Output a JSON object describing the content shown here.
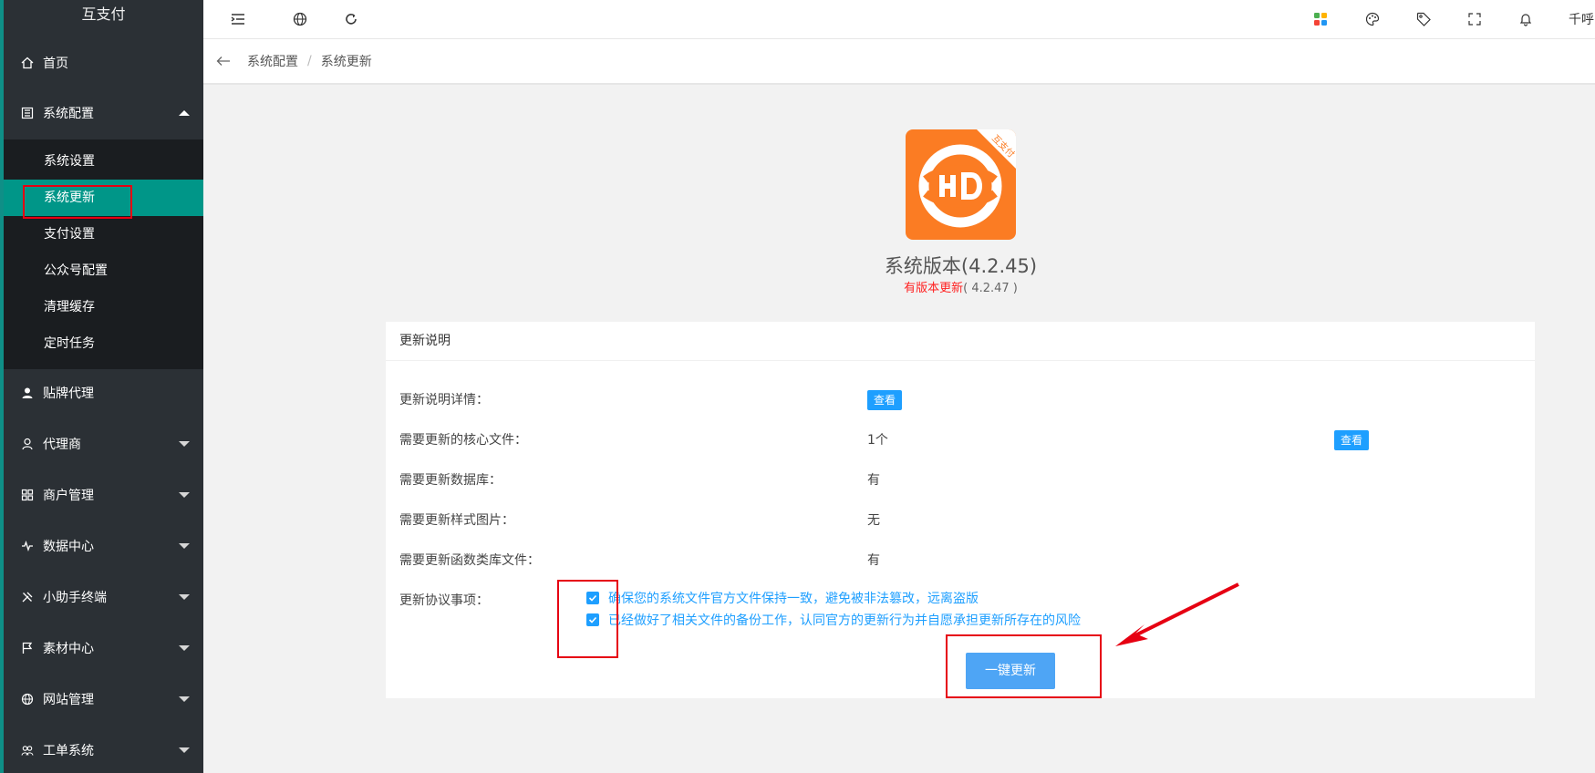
{
  "sidebar": {
    "logo": "互支付",
    "home": "首页",
    "system_config": "系统配置",
    "submenu": [
      "系统设置",
      "系统更新",
      "支付设置",
      "公众号配置",
      "清理缓存",
      "定时任务"
    ],
    "items": [
      "贴牌代理",
      "代理商",
      "商户管理",
      "数据中心",
      "小助手终端",
      "素材中心",
      "网站管理",
      "工单系统"
    ]
  },
  "topbar": {
    "user": "千呼"
  },
  "breadcrumb": {
    "parent": "系统配置",
    "current": "系统更新",
    "separator": "/"
  },
  "app": {
    "logo_badge": "互支付"
  },
  "version": {
    "title": "系统版本(4.2.45)",
    "update_label": "有版本更新",
    "new_version": "( 4.2.47 )"
  },
  "card": {
    "header": "更新说明",
    "rows": [
      {
        "label": "更新说明详情：",
        "value": ""
      },
      {
        "label": "需要更新的核心文件：",
        "value": "1个"
      },
      {
        "label": "需要更新数据库：",
        "value": "有"
      },
      {
        "label": "需要更新样式图片：",
        "value": "无"
      },
      {
        "label": "需要更新函数类库文件：",
        "value": "有"
      },
      {
        "label": "更新协议事项：",
        "value": ""
      }
    ],
    "view_button": "查看",
    "agreements": [
      "确保您的系统文件官方文件保持一致，避免被非法篡改，远离盗版",
      "已经做好了相关文件的备份工作，认同官方的更新行为并自愿承担更新所存在的风险"
    ],
    "update_button": "一键更新"
  },
  "colors": {
    "sidebar": "#2b3035",
    "active": "#009688",
    "primary": "#1e9fff",
    "highlight": "#e60012",
    "logo": "#fb7c23"
  }
}
